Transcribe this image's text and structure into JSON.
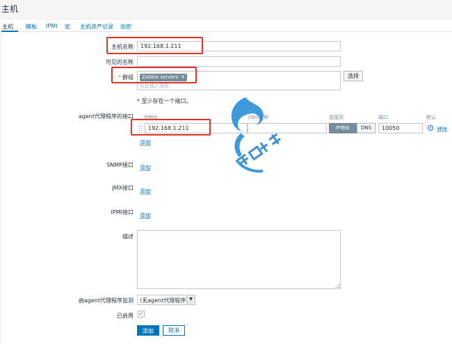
{
  "page": {
    "title": "主机"
  },
  "tabs": [
    {
      "label": "主机"
    },
    {
      "label": "模板"
    },
    {
      "label": "IPMI"
    },
    {
      "label": "宏"
    },
    {
      "label": "主机资产记录"
    },
    {
      "label": "加密"
    }
  ],
  "form": {
    "host_name": {
      "label": "主机名称",
      "value": "192.168.1.211"
    },
    "visible_name": {
      "label": "可见的名称",
      "value": ""
    },
    "groups": {
      "label": "群组",
      "chip": "Zabbix servers",
      "placeholder": "在此输入搜索",
      "select_button": "选择"
    },
    "hint": "* 至少存在一个接口。",
    "interfaces": {
      "agent_label": "agent代理程序的接口",
      "columns": {
        "ip": "IP地址",
        "dns": "DNS名称",
        "connect_to": "连接到",
        "port": "端口",
        "default": "默认"
      },
      "row": {
        "ip": "192.168.1.211",
        "dns": "",
        "ip_toggle": "IP地址",
        "dns_toggle": "DNS",
        "port": "10050",
        "remove": "移除"
      },
      "add_link": "添加",
      "snmp_label": "SNMP接口",
      "jmx_label": "JMX接口",
      "ipmi_label": "IPMI接口"
    },
    "description": {
      "label": "描述",
      "value": ""
    },
    "proxy": {
      "label": "由agent代理程序监测",
      "value": "(无agent代理程序)"
    },
    "enabled": {
      "label": "已启用",
      "checked": true
    },
    "buttons": {
      "add": "添加",
      "cancel": "取消"
    }
  },
  "colors": {
    "link": "#0275b8",
    "highlight": "#e0312b",
    "chip": "#768d99"
  }
}
